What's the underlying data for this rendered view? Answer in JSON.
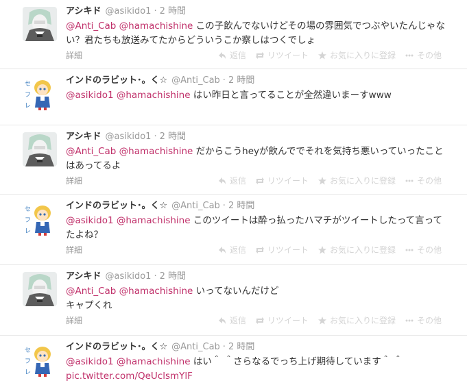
{
  "tweets": [
    {
      "avatar": "ashikido-avatar",
      "fullname": "アシキド",
      "username": "@asikido1",
      "time": "2 時間",
      "mentions": [
        "@Anti_Cab",
        "@hamachishine"
      ],
      "body": "この子飲んでないけどその場の雰囲気でつぶやいたんじゃない？君たちも放送みてたからどういうこか察しはつくでしょ",
      "link": "",
      "details": "詳細"
    },
    {
      "avatar": "rabbit-avatar",
      "fullname": "インドのラビット･。く☆",
      "username": "@Anti_Cab",
      "time": "2 時間",
      "mentions": [
        "@asikido1",
        "@hamachishine"
      ],
      "body": "はい昨日と言ってることが全然違いまーすwww",
      "link": "",
      "details": ""
    },
    {
      "avatar": "ashikido-avatar",
      "fullname": "アシキド",
      "username": "@asikido1",
      "time": "2 時間",
      "mentions": [
        "@Anti_Cab",
        "@hamachishine"
      ],
      "body": "だからこうheyが飲んででそれを気持ち悪いっていったことはあってるよ",
      "link": "",
      "details": "詳細"
    },
    {
      "avatar": "rabbit-avatar",
      "fullname": "インドのラビット･。く☆",
      "username": "@Anti_Cab",
      "time": "2 時間",
      "mentions": [
        "@asikido1",
        "@hamachishine"
      ],
      "body": "このツイートは酔っ払ったハマチがツイートしたって言ってたよね？",
      "link": "",
      "details": "詳細"
    },
    {
      "avatar": "ashikido-avatar",
      "fullname": "アシキド",
      "username": "@asikido1",
      "time": "2 時間",
      "mentions": [
        "@Anti_Cab",
        "@hamachishine"
      ],
      "body": "いってないんだけど\nキャプくれ",
      "link": "",
      "details": "詳細"
    },
    {
      "avatar": "rabbit-avatar",
      "fullname": "インドのラビット･。く☆",
      "username": "@Anti_Cab",
      "time": "2 時間",
      "mentions": [
        "@asikido1",
        "@hamachishine"
      ],
      "body": "はい＾ ＾さらなるでっち上げ期待しています＾ ＾",
      "link": "pic.twitter.com/QeUclsmYlF",
      "details": ""
    }
  ],
  "actions": {
    "reply": "返信",
    "retweet": "リツイート",
    "favorite": "お気に入りに登録",
    "more": "その他"
  },
  "colors": {
    "mention": "#c0306a",
    "meta": "#999999",
    "action": "#d4d4d4",
    "divider": "#e8e8e8"
  }
}
